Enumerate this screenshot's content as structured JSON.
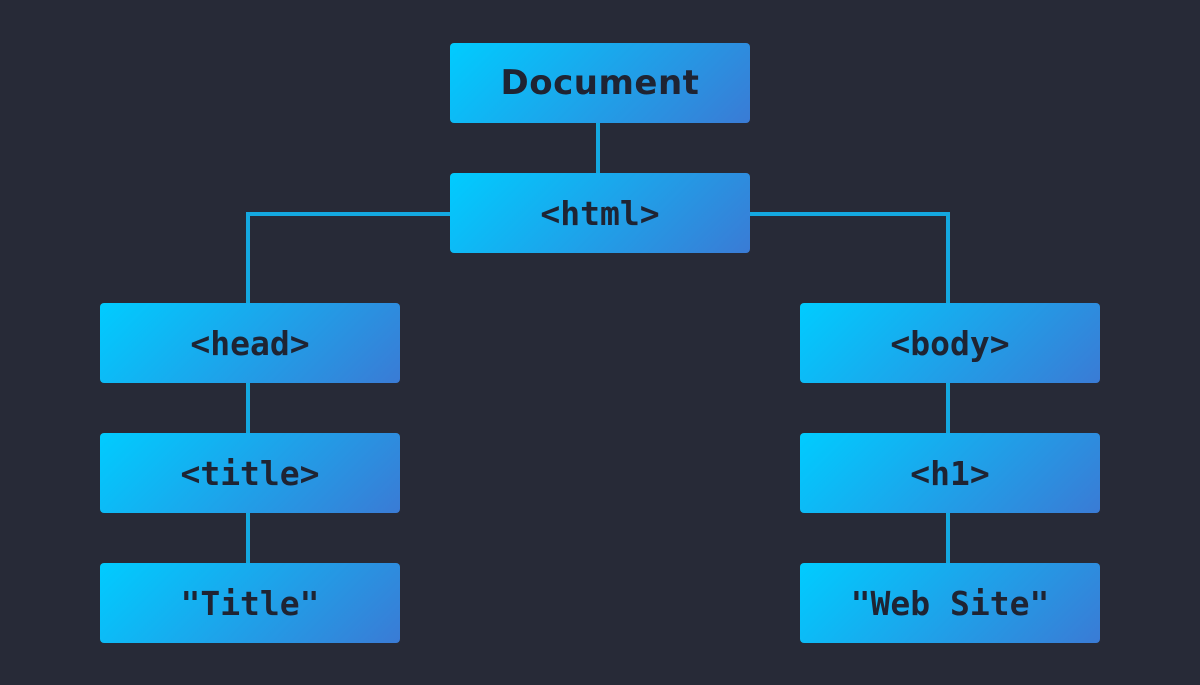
{
  "diagram": {
    "nodes": {
      "document": "Document",
      "html": "<html>",
      "head": "<head>",
      "title": "<title>",
      "title_text": "\"Title\"",
      "body": "<body>",
      "h1": "<h1>",
      "h1_text": "\"Web Site\""
    },
    "colors": {
      "background": "#272a37",
      "node_gradient_start": "#00ccff",
      "node_gradient_end": "#3a7bd5",
      "connector": "#14a8e0",
      "text": "#1f2433"
    }
  }
}
